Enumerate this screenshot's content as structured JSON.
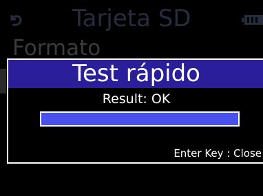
{
  "header": {
    "title": "Tarjeta SD",
    "back_icon": "back-arrow-icon",
    "battery_icon": "battery-icon"
  },
  "background_menu": {
    "item_label": "Formato"
  },
  "dialog": {
    "title": "Test rápido",
    "result": "Result: OK",
    "progress": 1.0,
    "hint": "Enter Key : Close"
  },
  "colors": {
    "titlebar": "#2a1e9a",
    "progress_fill": "#4a50ee",
    "dimmed_text": "#262d3f"
  }
}
